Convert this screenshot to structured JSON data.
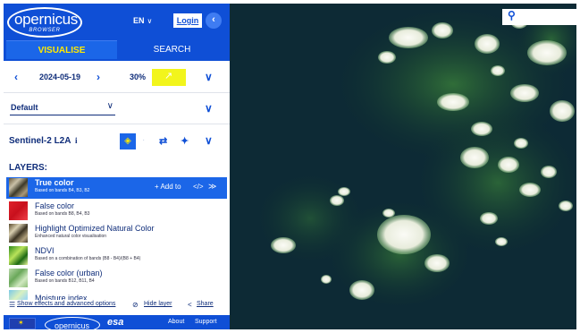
{
  "header": {
    "logo_text": "opernicus",
    "logo_sub": "BROWSER",
    "lang": "EN",
    "lang_chevron": "∨",
    "login": "Login",
    "back_icon": "chevron-left-icon",
    "back_glyph": "‹"
  },
  "tabs": [
    {
      "label": "VISUALISE",
      "active": true
    },
    {
      "label": "SEARCH",
      "active": false
    }
  ],
  "date_row": {
    "date": "2024-05-19",
    "prev_glyph": "‹",
    "next_glyph": "›",
    "cloud_cover": "30%",
    "expand_glyph": "∨"
  },
  "theme": {
    "value": "Default",
    "chevron": "∨",
    "expand_glyph": "∨"
  },
  "dataset": {
    "name": "Sentinel-2 L2A",
    "info": "i",
    "compare_glyph": "⇄",
    "pin_glyph": "✦",
    "expand_glyph": "∨"
  },
  "layers_title": "LAYERS:",
  "layers": [
    {
      "name": "True color",
      "desc": "Based on bands B4, B3, B2",
      "selected": true,
      "thumb": "true"
    },
    {
      "name": "False color",
      "desc": "Based on bands B8, B4, B3",
      "selected": false,
      "thumb": "false"
    },
    {
      "name": "Highlight Optimized Natural Color",
      "desc": "Enhanced natural color visualisation",
      "selected": false,
      "thumb": "hl"
    },
    {
      "name": "NDVI",
      "desc": "Based on a combination of bands (B8 - B4)/(B8 + B4)",
      "selected": false,
      "thumb": "ndvi"
    },
    {
      "name": "False color (urban)",
      "desc": "Based on bands B12, B11, B4",
      "selected": false,
      "thumb": "urban"
    },
    {
      "name": "Moisture index",
      "desc": "",
      "selected": false,
      "thumb": "moist"
    }
  ],
  "selected_actions": {
    "add_to": "+ Add to",
    "code": "</>",
    "collapse": "≫"
  },
  "effects_bar": {
    "show_effects": "Show effects and advanced options",
    "hide_layer": "Hide layer",
    "share": "Share"
  },
  "footer": {
    "copernicus": "opernicus",
    "esa": "esa",
    "about": "About",
    "support": "Support"
  },
  "map": {
    "search_icon": "search-icon",
    "search_glyph": "⚲"
  },
  "colors": {
    "brand_blue": "#0f4fd6",
    "accent_yellow": "#ffea00",
    "selected_row": "#1b66e8",
    "sea": "#0e2b38"
  }
}
